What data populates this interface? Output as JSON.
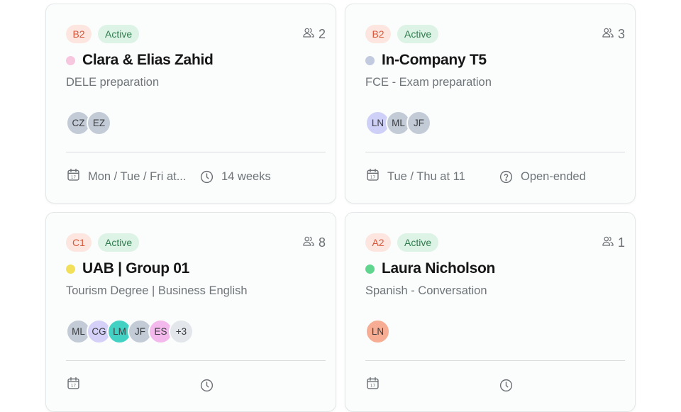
{
  "colors": {
    "level_bg": "#fde6df",
    "level_fg": "#d9573b",
    "status_bg": "#dcf3e6",
    "status_fg": "#2f7d4e"
  },
  "cards": [
    {
      "level": "B2",
      "status": "Active",
      "members": "2",
      "dot_color": "#f7c6df",
      "title": "Clara & Elias Zahid",
      "subtitle": "DELE preparation",
      "avatars": [
        {
          "initials": "CZ",
          "color": "#c3cbd6"
        },
        {
          "initials": "EZ",
          "color": "#c3cbd6"
        }
      ],
      "schedule": "Mon / Tue / Fri at...",
      "schedule_icon": "calendar-icon",
      "duration": "14 weeks",
      "duration_icon": "clock-icon"
    },
    {
      "level": "B2",
      "status": "Active",
      "members": "3",
      "dot_color": "#c1cade",
      "title": "In-Company T5",
      "subtitle": "FCE - Exam preparation",
      "avatars": [
        {
          "initials": "LN",
          "color": "#cfd0f7"
        },
        {
          "initials": "ML",
          "color": "#c3cbd6"
        },
        {
          "initials": "JF",
          "color": "#c3cbd6"
        }
      ],
      "schedule": "Tue / Thu at 11",
      "schedule_icon": "calendar-icon",
      "duration": "Open-ended",
      "duration_icon": "question-circle-icon"
    },
    {
      "level": "C1",
      "status": "Active",
      "members": "8",
      "dot_color": "#f3e05a",
      "title": "UAB | Group 01",
      "subtitle": "Tourism Degree | Business English",
      "avatars": [
        {
          "initials": "ML",
          "color": "#c3cbd6"
        },
        {
          "initials": "CG",
          "color": "#d5d0f7"
        },
        {
          "initials": "LM",
          "color": "#43d1c4"
        },
        {
          "initials": "JF",
          "color": "#c3cbd6"
        },
        {
          "initials": "ES",
          "color": "#f4b9ec"
        },
        {
          "initials": "+3",
          "color": "#e3e6ea"
        }
      ],
      "schedule": "",
      "schedule_icon": "calendar-icon",
      "duration": "",
      "duration_icon": "clock-icon"
    },
    {
      "level": "A2",
      "status": "Active",
      "members": "1",
      "dot_color": "#5fd58d",
      "title": "Laura Nicholson",
      "subtitle": "Spanish - Conversation",
      "avatars": [
        {
          "initials": "LN",
          "color": "#f6ad93"
        }
      ],
      "schedule": "",
      "schedule_icon": "calendar-icon",
      "duration": "",
      "duration_icon": "clock-icon"
    }
  ]
}
